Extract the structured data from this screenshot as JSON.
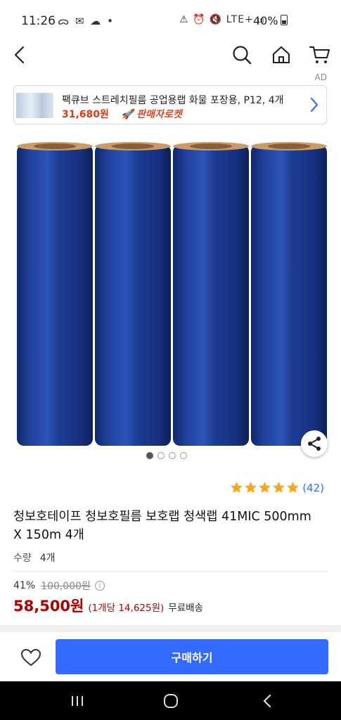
{
  "status_bar": {
    "time": "11:26",
    "left_icons": "ᯅ ✉ ☁ •",
    "right_icons": "⚠ ⏰ 🔇 LTE+ ᵢₗₗ",
    "battery": "40%"
  },
  "header": {
    "back_icon": "back-arrow-icon",
    "search_icon": "search-icon",
    "home_icon": "home-icon",
    "cart_icon": "cart-icon",
    "ad_label": "AD"
  },
  "ad_banner": {
    "title": "팩큐브 스트레치필름 공업용랩 화물 포장용, P12, 4개",
    "price": "31,680원",
    "badge": "🚀 판매자로켓",
    "chevron_icon": "chevron-right-icon"
  },
  "product": {
    "image_pager": {
      "count": 4,
      "active_index": 0
    },
    "rating": {
      "stars": 5,
      "count": "(42)"
    },
    "title": "청보호테이프 청보호필름 보호랩 청색랩 41MIC 500mm X 150m 4개",
    "quantity_label": "수량",
    "quantity_value": "4개",
    "discount_rate": "41%",
    "original_price": "100,000원",
    "sale_price": "58,500원",
    "unit_price": "(1개당 14,625원)",
    "shipping": "무료배송"
  },
  "bottom_bar": {
    "buy_label": "구매하기",
    "wish_icon": "heart-outline-icon"
  },
  "nav_bar": {
    "recent_icon": "recent-apps-icon",
    "home_icon": "home-circle-icon",
    "back_icon": "back-chevron-icon"
  },
  "colors": {
    "accent_blue": "#346aff",
    "price_red": "#ae0000",
    "ad_price_red": "#d93a18",
    "star_orange": "#f5a623",
    "roll_blue": "#1c3a8f"
  }
}
